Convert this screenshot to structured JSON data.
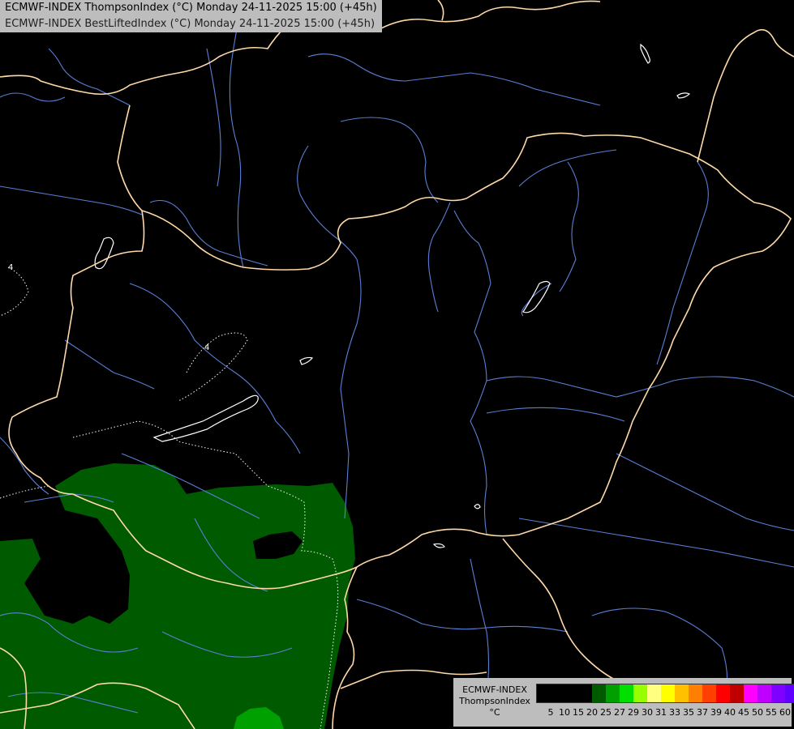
{
  "title": {
    "line1": "ECMWF-INDEX ThompsonIndex (°C) Monday 24-11-2025 15:00 (+45h)",
    "line2": "ECMWF-INDEX BestLiftedIndex (°C) Monday 24-11-2025 15:00 (+45h)"
  },
  "contour_labels": [
    "4",
    "4"
  ],
  "legend": {
    "model": "ECMWF-INDEX",
    "parameter": "ThompsonIndex",
    "unit": "°C",
    "colors": [
      "#000000",
      "#000000",
      "#000000",
      "#000000",
      "#005a00",
      "#00a000",
      "#00e000",
      "#98ff00",
      "#ffff80",
      "#ffff00",
      "#ffc000",
      "#ff8000",
      "#ff4000",
      "#ff0000",
      "#c00000",
      "#ff00ff",
      "#c000ff",
      "#8000ff",
      "#6000ff",
      "#0000ff"
    ],
    "ticks": [
      "5",
      "10",
      "15",
      "20",
      "25",
      "27",
      "29",
      "30",
      "31",
      "33",
      "35",
      "37",
      "39",
      "40",
      "45",
      "50",
      "55",
      "60"
    ]
  },
  "colors": {
    "background": "#000000",
    "border": "#ffd9a8",
    "river": "#5a7fd6",
    "contour": "#ffffff",
    "thompson_25": "#005a00",
    "thompson_27": "#00a000"
  }
}
